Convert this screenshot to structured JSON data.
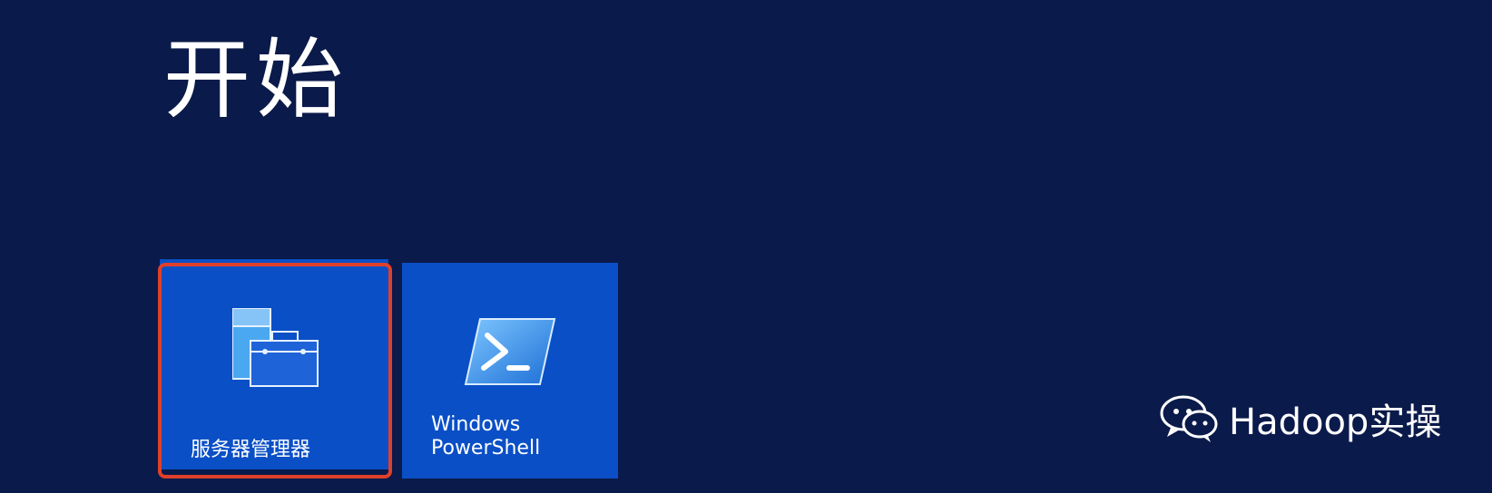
{
  "start_screen": {
    "title": "开始"
  },
  "tiles": [
    {
      "label": "服务器管理器",
      "icon": "server-manager-icon",
      "highlighted": true,
      "highlight_color": "#e0402a"
    },
    {
      "label_line1": "Windows",
      "label_line2": "PowerShell",
      "icon": "powershell-icon"
    }
  ],
  "watermark": {
    "text": "Hadoop实操",
    "icon": "wechat-icon"
  },
  "colors": {
    "background": "#0a1a4a",
    "tile": "#0a4fc6",
    "text": "#ffffff"
  }
}
